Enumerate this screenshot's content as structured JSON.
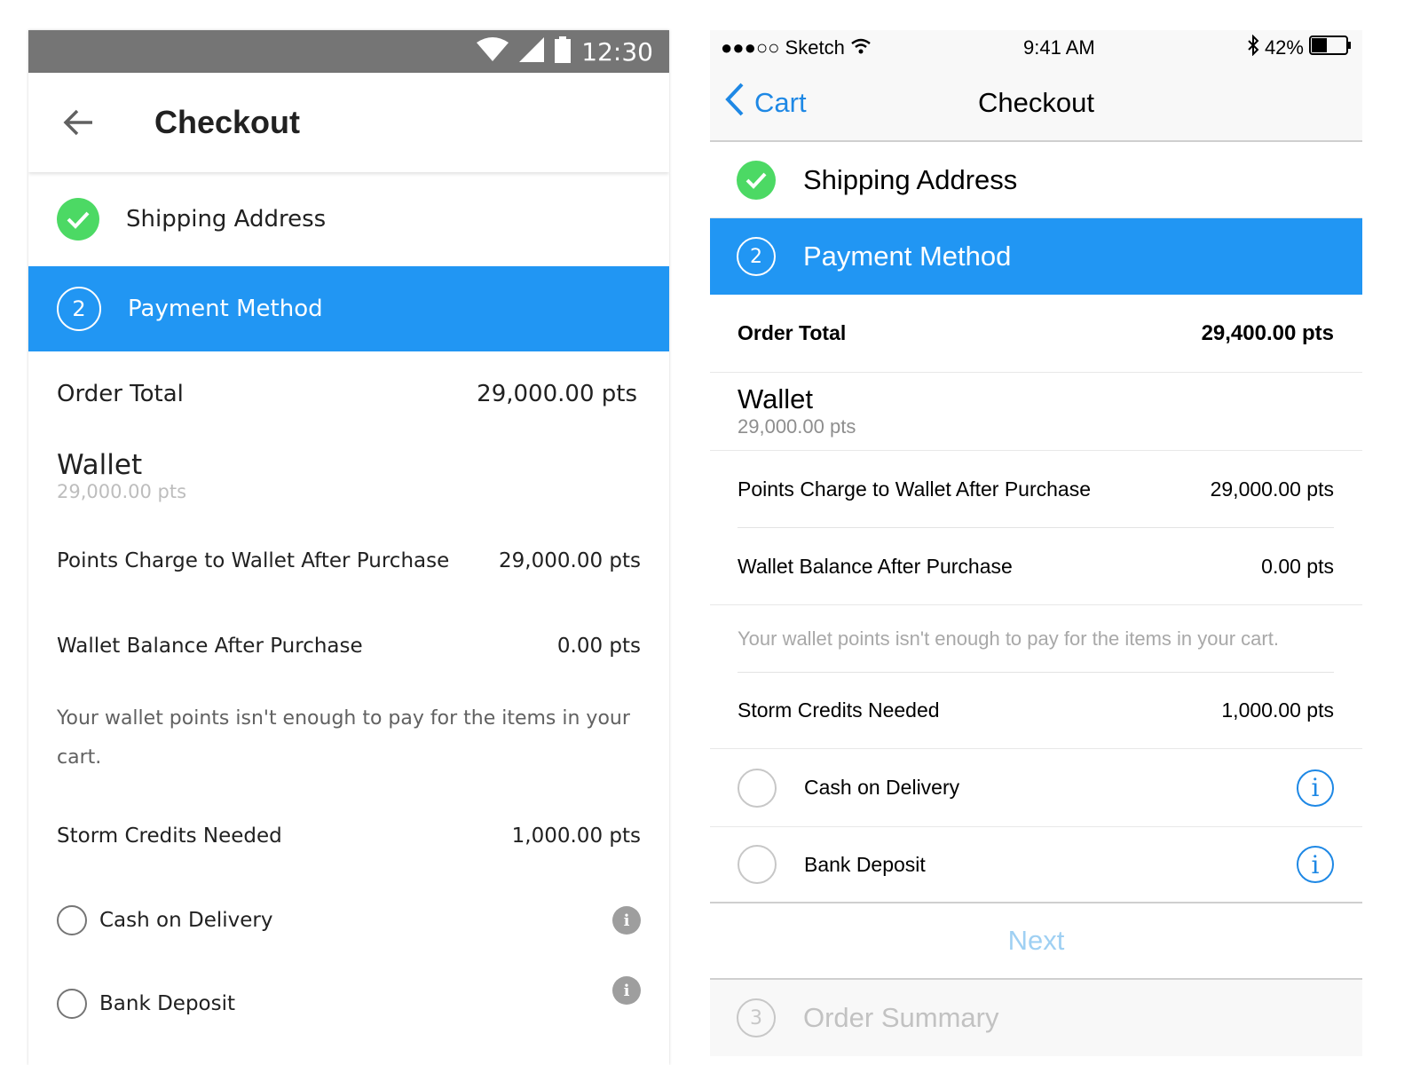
{
  "android": {
    "status_time": "12:30",
    "title": "Checkout",
    "steps": [
      {
        "label": "Shipping Address"
      },
      {
        "number": "2",
        "label": "Payment Method"
      }
    ],
    "order_total_label": "Order Total",
    "order_total_value": "29,000.00 pts",
    "wallet_title": "Wallet",
    "wallet_balance": "29,000.00 pts",
    "points_charge_label": "Points Charge to Wallet After Purchase",
    "points_charge_value": "29,000.00 pts",
    "balance_after_label": "Wallet Balance After Purchase",
    "balance_after_value": "0.00 pts",
    "note": "Your wallet points isn't enough to pay for the items in your cart.",
    "credits_label": "Storm Credits Needed",
    "credits_value": "1,000.00 pts",
    "payment_options": [
      {
        "label": "Cash on Delivery"
      },
      {
        "label": "Bank Deposit"
      }
    ]
  },
  "ios": {
    "carrier": "●●●○○ Sketch",
    "time": "9:41 AM",
    "battery": "42%",
    "back_label": "Cart",
    "title": "Checkout",
    "steps": [
      {
        "label": "Shipping Address"
      },
      {
        "number": "2",
        "label": "Payment Method"
      },
      {
        "number": "3",
        "label": "Order Summary"
      }
    ],
    "order_total_label": "Order Total",
    "order_total_value": "29,400.00 pts",
    "wallet_title": "Wallet",
    "wallet_balance": "29,000.00 pts",
    "points_charge_label": "Points Charge to Wallet After Purchase",
    "points_charge_value": "29,000.00 pts",
    "balance_after_label": "Wallet Balance After Purchase",
    "balance_after_value": "0.00 pts",
    "note": "Your wallet points isn't enough to pay for the items in your cart.",
    "credits_label": "Storm Credits Needed",
    "credits_value": "1,000.00 pts",
    "payment_options": [
      {
        "label": "Cash on Delivery"
      },
      {
        "label": "Bank Deposit"
      }
    ],
    "next_label": "Next"
  },
  "colors": {
    "accent_blue": "#2196F3",
    "success_green": "#4CD964",
    "ios_tint": "#1E88E5"
  },
  "icons": [
    "wifi-icon",
    "cellular-signal-icon",
    "battery-icon",
    "back-arrow-icon",
    "checkmark-icon",
    "info-icon",
    "bluetooth-icon",
    "chevron-left-icon"
  ]
}
